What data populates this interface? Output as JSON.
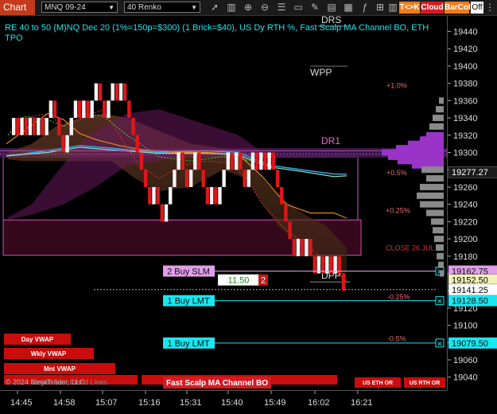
{
  "toolbar": {
    "chart_label": "Chart",
    "instrument": "MNQ 09-24",
    "bar_type": "40 Renko",
    "tick_btn": "T<>K",
    "cloud_btn": "Cloud",
    "barcol_btn": "BarCol",
    "off_btn": "Off",
    "icons": [
      "arrow-icon",
      "bars-icon",
      "crosshair-icon",
      "zoom-in-icon",
      "zoom-out-icon",
      "properties-icon",
      "templates-icon",
      "draw-icon",
      "strategies-icon",
      "chart-trader-icon",
      "indicators-icon",
      "lock-icon",
      "columns-icon",
      "grid-icon",
      "share-icon"
    ]
  },
  "header_text": "RE 40 to 50 (M)NQ Dec 20 (1%=150p=$300) (1 Brick=$40), US Dy RTH %, Fast Scalp MA Channel BO, ETH TPO",
  "levels": [
    {
      "label": "DRS",
      "price": 19448
    },
    {
      "label": "WPP",
      "price": 19387
    },
    {
      "label": "+1.0%",
      "price": 19373
    },
    {
      "label": "DR1",
      "price": 19308
    },
    {
      "label": "+0.5%",
      "price": 19272
    },
    {
      "label": "+0.25%",
      "price": 19228
    },
    {
      "label": "CLOSE 26 JUL",
      "price": 19185
    },
    {
      "label": "DPP",
      "price": 19152
    },
    {
      "label": "-0.25%",
      "price": 19128
    },
    {
      "label": "-0.5%",
      "price": 19080
    }
  ],
  "orders": [
    {
      "label": "2 Buy SLM",
      "price": 19162.75,
      "price_label": "19162.75",
      "color": "#e29ee8"
    },
    {
      "label": "1 Buy LMT",
      "price": 19128.5,
      "price_label": "19128.50",
      "color": "#19e6ef"
    },
    {
      "label": "1 Buy LMT",
      "price": 19079.5,
      "price_label": "19079.50",
      "color": "#19e6ef"
    }
  ],
  "position": {
    "pnl": "11.50",
    "quantity": "2"
  },
  "price_markers": [
    {
      "label": "19277.27",
      "price": 19277.27,
      "bg": "#1a1a1a",
      "fg": "#ffffff"
    },
    {
      "label": "19152.50",
      "price": 19152.5,
      "bg": "#f2f2b8",
      "fg": "#000000"
    },
    {
      "label": "19141.25",
      "price": 19141.25,
      "bg": "#ffffff",
      "fg": "#000000"
    }
  ],
  "bottom_labels": [
    {
      "text": "Day VWAP"
    },
    {
      "text": "Wkly VWAP"
    },
    {
      "text": "Mnt VWAP"
    },
    {
      "text": "Fast Scalp MA Channel BO"
    },
    {
      "text": "US ETH OR"
    },
    {
      "text": "US RTH OR"
    }
  ],
  "copyright": "© 2024 NinjaTrader, LLC",
  "copyright_overlay": "Zenith Fast Cloud Lines",
  "chart_data": {
    "type": "line",
    "title": "",
    "y_ticks": [
      19440,
      19420,
      19400,
      19380,
      19360,
      19340,
      19320,
      19300,
      19280,
      19260,
      19240,
      19220,
      19200,
      19180,
      19160,
      19140,
      19120,
      19100,
      19080,
      19060,
      19040
    ],
    "ylim": [
      19025,
      19458
    ],
    "x_ticks": [
      "14:45",
      "14:58",
      "15:07",
      "15:16",
      "15:31",
      "15:40",
      "15:49",
      "16:02",
      "16:21"
    ],
    "renko_brick_size": 20,
    "renko_path": [
      19320,
      19340,
      19320,
      19340,
      19320,
      19340,
      19320,
      19340,
      19320,
      19340,
      19360,
      19340,
      19320,
      19300,
      19320,
      19340,
      19360,
      19340,
      19360,
      19340,
      19360,
      19380,
      19360,
      19340,
      19360,
      19380,
      19360,
      19380,
      19360,
      19340,
      19320,
      19300,
      19280,
      19260,
      19240,
      19260,
      19240,
      19220,
      19240,
      19260,
      19280,
      19300,
      19280,
      19260,
      19280,
      19300,
      19280,
      19260,
      19240,
      19260,
      19240,
      19260,
      19280,
      19300,
      19280,
      19300,
      19280,
      19260,
      19280,
      19300,
      19280,
      19300,
      19280,
      19300,
      19280,
      19260,
      19240,
      19220,
      19200,
      19180,
      19200,
      19180,
      19200,
      19180,
      19160,
      19180,
      19160,
      19180,
      19160,
      19180,
      19160,
      19140
    ]
  }
}
